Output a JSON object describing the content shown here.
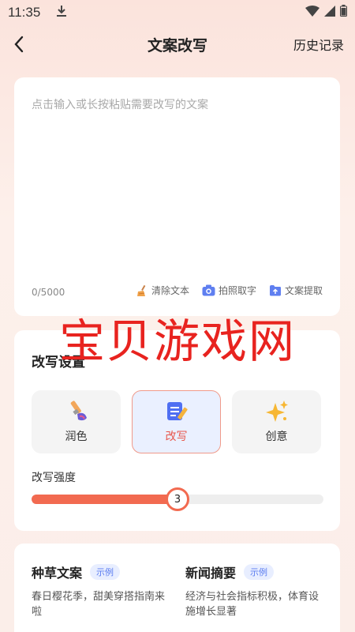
{
  "status_bar": {
    "time": "11:35"
  },
  "nav": {
    "title": "文案改写",
    "history": "历史记录"
  },
  "input": {
    "placeholder": "点击输入或长按粘贴需要改写的文案",
    "count": "0/5000",
    "tools": [
      {
        "label": "清除文本",
        "icon": "broom-icon"
      },
      {
        "label": "拍照取字",
        "icon": "camera-icon"
      },
      {
        "label": "文案提取",
        "icon": "upload-icon"
      }
    ]
  },
  "settings": {
    "title": "改写设置",
    "modes": [
      {
        "label": "润色",
        "icon": "brush-icon"
      },
      {
        "label": "改写",
        "icon": "edit-doc-icon",
        "selected": true
      },
      {
        "label": "创意",
        "icon": "sparkle-icon"
      }
    ],
    "strength_label": "改写强度",
    "strength_value": "3",
    "strength_fraction": 0.5
  },
  "examples": [
    {
      "title": "种草文案",
      "badge": "示例",
      "desc": "春日樱花季，甜美穿搭指南来啦"
    },
    {
      "title": "新闻摘要",
      "badge": "示例",
      "desc": "经济与社会指标积极，体育设施增长显著"
    }
  ],
  "watermark": "宝贝游戏网",
  "colors": {
    "accent": "#f26a50",
    "badge": "#5a7cf0",
    "watermark": "#e8231f"
  }
}
